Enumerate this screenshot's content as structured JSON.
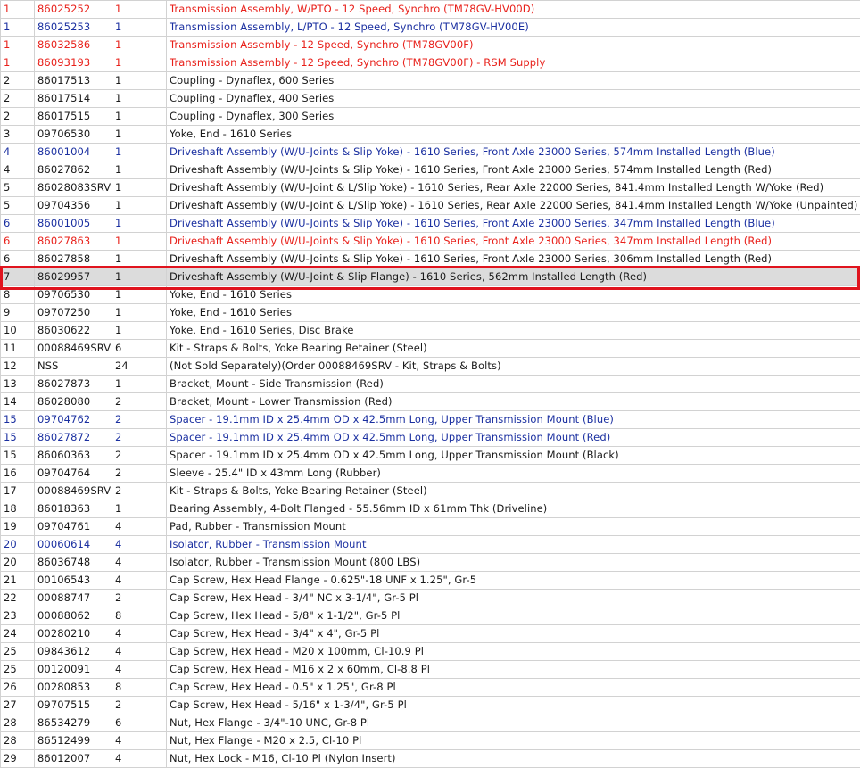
{
  "accent_colors": {
    "red_row": "#e8201a",
    "blue_row": "#1a2fa0",
    "selection_outline": "#e0141e",
    "selected_bg": "#dcdcdc"
  },
  "selected_row_index": 15,
  "rows": [
    {
      "ref": "1",
      "part": "86025252",
      "qty": "1",
      "desc": "Transmission Assembly, W/PTO - 12 Speed, Synchro (TM78GV-HV00D)",
      "color": "red"
    },
    {
      "ref": "1",
      "part": "86025253",
      "qty": "1",
      "desc": "Transmission Assembly, L/PTO - 12 Speed, Synchro (TM78GV-HV00E)",
      "color": "blue"
    },
    {
      "ref": "1",
      "part": "86032586",
      "qty": "1",
      "desc": "Transmission Assembly - 12 Speed, Synchro (TM78GV00F)",
      "color": "red"
    },
    {
      "ref": "1",
      "part": "86093193",
      "qty": "1",
      "desc": "Transmission Assembly - 12 Speed, Synchro (TM78GV00F) - RSM Supply",
      "color": "red"
    },
    {
      "ref": "2",
      "part": "86017513",
      "qty": "1",
      "desc": "Coupling - Dynaflex, 600 Series",
      "color": ""
    },
    {
      "ref": "2",
      "part": "86017514",
      "qty": "1",
      "desc": "Coupling - Dynaflex, 400 Series",
      "color": ""
    },
    {
      "ref": "2",
      "part": "86017515",
      "qty": "1",
      "desc": "Coupling - Dynaflex, 300 Series",
      "color": ""
    },
    {
      "ref": "3",
      "part": "09706530",
      "qty": "1",
      "desc": "Yoke, End - 1610 Series",
      "color": ""
    },
    {
      "ref": "4",
      "part": "86001004",
      "qty": "1",
      "desc": "Driveshaft Assembly (W/U-Joints & Slip Yoke) - 1610 Series, Front Axle 23000 Series, 574mm Installed Length (Blue)",
      "color": "blue"
    },
    {
      "ref": "4",
      "part": "86027862",
      "qty": "1",
      "desc": "Driveshaft Assembly (W/U-Joints & Slip Yoke) - 1610 Series, Front Axle 23000 Series, 574mm Installed Length (Red)",
      "color": ""
    },
    {
      "ref": "5",
      "part": "86028083SRV",
      "qty": "1",
      "desc": "Driveshaft Assembly (W/U-Joint & L/Slip Yoke) - 1610 Series, Rear Axle 22000 Series, 841.4mm Installed Length W/Yoke (Red)",
      "color": ""
    },
    {
      "ref": "5",
      "part": "09704356",
      "qty": "1",
      "desc": "Driveshaft Assembly (W/U-Joint & L/Slip Yoke) - 1610 Series, Rear Axle 22000 Series, 841.4mm Installed Length W/Yoke (Unpainted)",
      "color": ""
    },
    {
      "ref": "6",
      "part": "86001005",
      "qty": "1",
      "desc": "Driveshaft Assembly (W/U-Joints & Slip Yoke) - 1610 Series, Front Axle 23000 Series, 347mm Installed Length (Blue)",
      "color": "blue"
    },
    {
      "ref": "6",
      "part": "86027863",
      "qty": "1",
      "desc": "Driveshaft Assembly (W/U-Joints & Slip Yoke) - 1610 Series, Front Axle 23000 Series, 347mm Installed Length (Red)",
      "color": "red"
    },
    {
      "ref": "6",
      "part": "86027858",
      "qty": "1",
      "desc": "Driveshaft Assembly (W/U-Joints & Slip Yoke) - 1610 Series, Front Axle 23000 Series, 306mm Installed Length (Red)",
      "color": ""
    },
    {
      "ref": "7",
      "part": "86029957",
      "qty": "1",
      "desc": "Driveshaft Assembly (W/U-Joint & Slip Flange) - 1610 Series, 562mm Installed Length (Red)",
      "color": ""
    },
    {
      "ref": "8",
      "part": "09706530",
      "qty": "1",
      "desc": "Yoke, End - 1610 Series",
      "color": ""
    },
    {
      "ref": "9",
      "part": "09707250",
      "qty": "1",
      "desc": "Yoke, End - 1610 Series",
      "color": ""
    },
    {
      "ref": "10",
      "part": "86030622",
      "qty": "1",
      "desc": "Yoke, End - 1610 Series, Disc Brake",
      "color": ""
    },
    {
      "ref": "11",
      "part": "00088469SRV",
      "qty": "6",
      "desc": "Kit - Straps & Bolts, Yoke Bearing Retainer (Steel)",
      "color": ""
    },
    {
      "ref": "12",
      "part": "NSS",
      "qty": "24",
      "desc": "(Not Sold Separately)(Order 00088469SRV - Kit, Straps & Bolts)",
      "color": ""
    },
    {
      "ref": "13",
      "part": "86027873",
      "qty": "1",
      "desc": "Bracket, Mount - Side Transmission (Red)",
      "color": ""
    },
    {
      "ref": "14",
      "part": "86028080",
      "qty": "2",
      "desc": "Bracket, Mount - Lower Transmission (Red)",
      "color": ""
    },
    {
      "ref": "15",
      "part": "09704762",
      "qty": "2",
      "desc": "Spacer - 19.1mm ID x 25.4mm OD x 42.5mm Long, Upper Transmission Mount (Blue)",
      "color": "blue"
    },
    {
      "ref": "15",
      "part": "86027872",
      "qty": "2",
      "desc": "Spacer - 19.1mm ID x 25.4mm OD x 42.5mm Long, Upper Transmission Mount (Red)",
      "color": "blue"
    },
    {
      "ref": "15",
      "part": "86060363",
      "qty": "2",
      "desc": "Spacer - 19.1mm ID x 25.4mm OD x 42.5mm Long, Upper Transmission Mount (Black)",
      "color": ""
    },
    {
      "ref": "16",
      "part": "09704764",
      "qty": "2",
      "desc": "Sleeve - 25.4\" ID x 43mm Long (Rubber)",
      "color": ""
    },
    {
      "ref": "17",
      "part": "00088469SRV",
      "qty": "2",
      "desc": "Kit - Straps & Bolts, Yoke Bearing Retainer (Steel)",
      "color": ""
    },
    {
      "ref": "18",
      "part": "86018363",
      "qty": "1",
      "desc": "Bearing Assembly, 4-Bolt Flanged - 55.56mm ID x 61mm Thk (Driveline)",
      "color": ""
    },
    {
      "ref": "19",
      "part": "09704761",
      "qty": "4",
      "desc": "Pad, Rubber - Transmission Mount",
      "color": ""
    },
    {
      "ref": "20",
      "part": "00060614",
      "qty": "4",
      "desc": "Isolator, Rubber - Transmission Mount",
      "color": "blue"
    },
    {
      "ref": "20",
      "part": "86036748",
      "qty": "4",
      "desc": "Isolator, Rubber - Transmission Mount (800 LBS)",
      "color": ""
    },
    {
      "ref": "21",
      "part": "00106543",
      "qty": "4",
      "desc": "Cap Screw, Hex Head Flange - 0.625\"-18 UNF x 1.25\", Gr-5",
      "color": ""
    },
    {
      "ref": "22",
      "part": "00088747",
      "qty": "2",
      "desc": "Cap Screw, Hex Head - 3/4\" NC x 3-1/4\", Gr-5 Pl",
      "color": ""
    },
    {
      "ref": "23",
      "part": "00088062",
      "qty": "8",
      "desc": "Cap Screw, Hex Head - 5/8\" x 1-1/2\", Gr-5 Pl",
      "color": ""
    },
    {
      "ref": "24",
      "part": "00280210",
      "qty": "4",
      "desc": "Cap Screw, Hex Head - 3/4\" x 4\", Gr-5 Pl",
      "color": ""
    },
    {
      "ref": "25",
      "part": "09843612",
      "qty": "4",
      "desc": "Cap Screw, Hex Head - M20 x 100mm, Cl-10.9 Pl",
      "color": ""
    },
    {
      "ref": "25",
      "part": "00120091",
      "qty": "4",
      "desc": "Cap Screw, Hex Head - M16 x 2 x 60mm, Cl-8.8 Pl",
      "color": ""
    },
    {
      "ref": "26",
      "part": "00280853",
      "qty": "8",
      "desc": "Cap Screw, Hex Head - 0.5\" x 1.25\", Gr-8 Pl",
      "color": ""
    },
    {
      "ref": "27",
      "part": "09707515",
      "qty": "2",
      "desc": "Cap Screw, Hex Head - 5/16\" x 1-3/4\", Gr-5 Pl",
      "color": ""
    },
    {
      "ref": "28",
      "part": "86534279",
      "qty": "6",
      "desc": "Nut, Hex Flange - 3/4\"-10 UNC, Gr-8 Pl",
      "color": ""
    },
    {
      "ref": "28",
      "part": "86512499",
      "qty": "4",
      "desc": "Nut, Hex Flange - M20 x 2.5, Cl-10 Pl",
      "color": ""
    },
    {
      "ref": "29",
      "part": "86012007",
      "qty": "4",
      "desc": "Nut, Hex Lock - M16, Cl-10 Pl (Nylon Insert)",
      "color": ""
    }
  ]
}
